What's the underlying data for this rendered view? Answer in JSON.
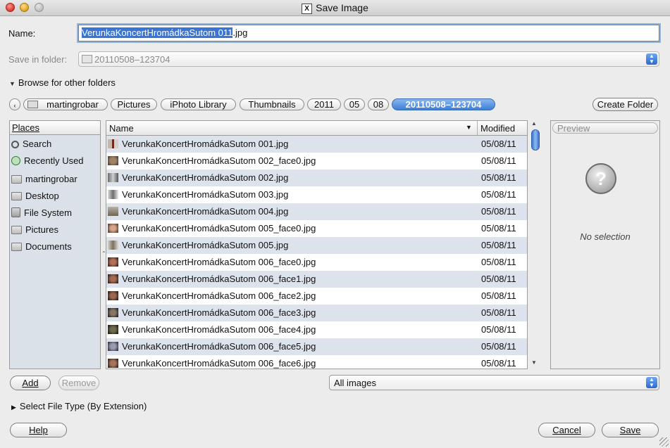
{
  "window": {
    "title": "Save Image"
  },
  "name": {
    "label": "Name:",
    "value_selected": "VerunkaKoncertHromádkaSutom 011",
    "value_rest": ".jpg"
  },
  "save_in": {
    "label": "Save in folder:",
    "value": "20110508–123704"
  },
  "browse": {
    "label": "Browse for other folders"
  },
  "path": {
    "items": [
      "martingrobar",
      "Pictures",
      "iPhoto Library",
      "Thumbnails",
      "2011",
      "05",
      "08",
      "20110508–123704"
    ],
    "create_folder": "Create Folder"
  },
  "places": {
    "header": "Places",
    "items": [
      {
        "label": "Search",
        "icon": "search-icon"
      },
      {
        "label": "Recently Used",
        "icon": "recent-icon"
      },
      {
        "label": "martingrobar",
        "icon": "folder-icon"
      },
      {
        "label": "Desktop",
        "icon": "folder-icon"
      },
      {
        "label": "File System",
        "icon": "drive-icon"
      },
      {
        "label": "Pictures",
        "icon": "folder-icon"
      },
      {
        "label": "Documents",
        "icon": "folder-icon"
      }
    ]
  },
  "files": {
    "columns": {
      "name": "Name",
      "modified": "Modified"
    },
    "rows": [
      {
        "name": "VerunkaKoncertHromádkaSutom 001.jpg",
        "modified": "05/08/11"
      },
      {
        "name": "VerunkaKoncertHromádkaSutom 002_face0.jpg",
        "modified": "05/08/11"
      },
      {
        "name": "VerunkaKoncertHromádkaSutom 002.jpg",
        "modified": "05/08/11"
      },
      {
        "name": "VerunkaKoncertHromádkaSutom 003.jpg",
        "modified": "05/08/11"
      },
      {
        "name": "VerunkaKoncertHromádkaSutom 004.jpg",
        "modified": "05/08/11"
      },
      {
        "name": "VerunkaKoncertHromádkaSutom 005_face0.jpg",
        "modified": "05/08/11"
      },
      {
        "name": "VerunkaKoncertHromádkaSutom 005.jpg",
        "modified": "05/08/11"
      },
      {
        "name": "VerunkaKoncertHromádkaSutom 006_face0.jpg",
        "modified": "05/08/11"
      },
      {
        "name": "VerunkaKoncertHromádkaSutom 006_face1.jpg",
        "modified": "05/08/11"
      },
      {
        "name": "VerunkaKoncertHromádkaSutom 006_face2.jpg",
        "modified": "05/08/11"
      },
      {
        "name": "VerunkaKoncertHromádkaSutom 006_face3.jpg",
        "modified": "05/08/11"
      },
      {
        "name": "VerunkaKoncertHromádkaSutom 006_face4.jpg",
        "modified": "05/08/11"
      },
      {
        "name": "VerunkaKoncertHromádkaSutom 006_face5.jpg",
        "modified": "05/08/11"
      },
      {
        "name": "VerunkaKoncertHromádkaSutom 006_face6.jpg",
        "modified": "05/08/11"
      }
    ]
  },
  "preview": {
    "header": "Preview",
    "empty_text": "No selection"
  },
  "buttons": {
    "add": "Add",
    "remove": "Remove",
    "help": "Help",
    "cancel": "Cancel",
    "save": "Save"
  },
  "filter": {
    "value": "All images"
  },
  "file_type": {
    "label": "Select File Type (By Extension)"
  },
  "colors": {
    "selection": "#3875d7",
    "row_alt": "#dde3ec",
    "active_path": "#3f7fd8"
  }
}
